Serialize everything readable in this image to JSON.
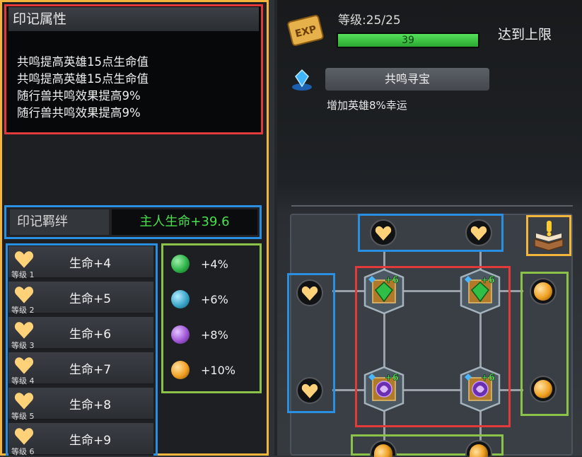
{
  "left": {
    "attr_title": "印记属性",
    "attr_lines": [
      "共鸣提高英雄15点生命值",
      "共鸣提高英雄15点生命值",
      "随行兽共鸣效果提高9%",
      "随行兽共鸣效果提高9%"
    ],
    "bond_label": "印记羁绊",
    "bond_value": "主人生命+39.6",
    "levels": [
      {
        "level": "等级 1",
        "effect": "生命+4"
      },
      {
        "level": "等级 2",
        "effect": "生命+5"
      },
      {
        "level": "等级 3",
        "effect": "生命+6"
      },
      {
        "level": "等级 4",
        "effect": "生命+7"
      },
      {
        "level": "等级 5",
        "effect": "生命+8"
      },
      {
        "level": "等级 6",
        "effect": "生命+9"
      }
    ],
    "orbs": [
      {
        "label": "+4%",
        "color": "#2fb34a"
      },
      {
        "label": "+6%",
        "color": "#3aa6c9"
      },
      {
        "label": "+8%",
        "color": "#a056d6"
      },
      {
        "label": "+10%",
        "color": "#f0a021"
      }
    ]
  },
  "right": {
    "exp_icon": "EXP",
    "level_text": "等级:25/25",
    "exp_value": "39",
    "exp_progress": 1.0,
    "max_text": "达到上限",
    "skill_name": "共鸣寻宝",
    "skill_desc": "增加英雄8%幸运",
    "node_badges": [
      "+6",
      "+6",
      "+6",
      "+6"
    ],
    "icons": {
      "skill": "blue-gem-icon",
      "book": "book-exclamation-icon",
      "heart": "heart-icon",
      "orb": "orange-orb-icon"
    }
  },
  "colors": {
    "highlight_red": "#e23a3a",
    "highlight_blue": "#2a8fe0",
    "highlight_green": "#8bc34a",
    "highlight_orange": "#f3b53c",
    "bond_value": "#48e04c"
  }
}
